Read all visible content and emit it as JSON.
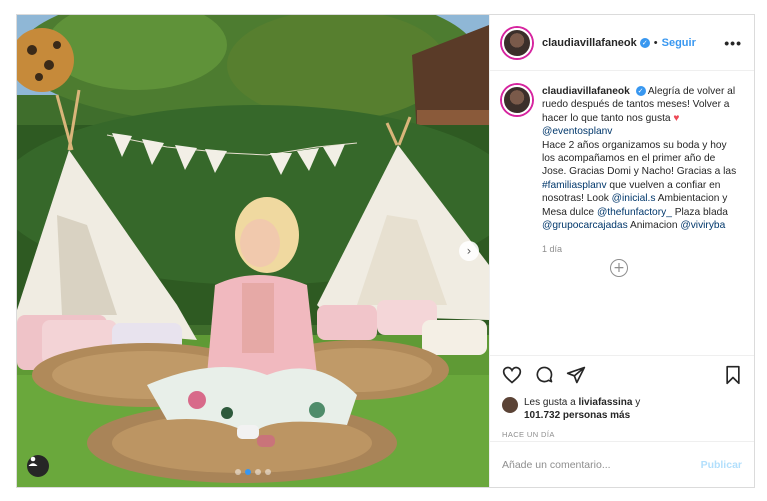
{
  "header": {
    "username": "claudiavillafaneok",
    "separator": "•",
    "follow_label": "Seguir",
    "more_icon": "more-horizontal-icon",
    "more_label": "•••"
  },
  "caption": {
    "username": "claudiavillafaneok",
    "text_1": "Alegría de volver al ruedo después de tantos meses! Volver a hacer lo que tanto nos gusta",
    "heart": "♥",
    "mention_eventos": "@eventosplanv",
    "text_2": "Hace 2 años organizamos su boda y hoy los acompañamos en el primer año de Jose. Gracias Domi y Nacho! Gracias a las",
    "hashtag": "#familiasplanv",
    "text_3": "que vuelven a confiar en nosotras! Look",
    "mention_inicial": "@inicial.s",
    "text_4": "Ambientacion y Mesa dulce",
    "mention_funfactory": "@thefunfactory_",
    "text_5": "Plaza blada",
    "mention_grupo": "@grupocarcajadas",
    "text_6": "Animacion",
    "mention_viviry": "@viviryba",
    "time": "1 día"
  },
  "load_more": {
    "icon": "plus-circle-icon",
    "label": "+"
  },
  "actions": {
    "like_icon": "heart-icon",
    "comment_icon": "comment-icon",
    "share_icon": "paper-plane-icon",
    "save_icon": "bookmark-icon"
  },
  "likes": {
    "prefix": "Les gusta a",
    "user": "liviafassina",
    "connector": "y",
    "count": "101.732 personas más"
  },
  "posted_ago": "HACE UN DÍA",
  "comment_box": {
    "placeholder": "Añade un comentario...",
    "publish_label": "Publicar"
  },
  "photo": {
    "next_label": "›",
    "next_icon": "chevron-right-icon",
    "user_tag_icon": "person-icon",
    "carousel_dots": 4,
    "active_dot": 1
  },
  "colors": {
    "accent": "#3897f0",
    "heart": "#ed4956",
    "mention": "#00376b",
    "publish_disabled": "#b2dffc"
  }
}
